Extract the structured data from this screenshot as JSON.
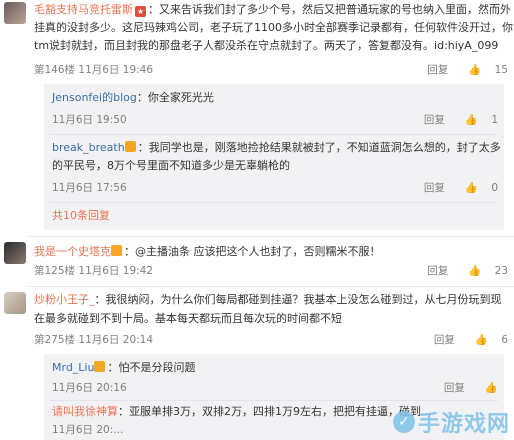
{
  "actions": {
    "reply": "回复",
    "like_glyph": "👍"
  },
  "comment1": {
    "user": "毛豁支持马竞托雷斯",
    "text_lines": [
      "：又来告诉我们封了多少个号，然后又把普通玩家的号也纳入里面，然而外",
      "挂真的没封多少。这尼玛辣鸡公司，老子玩了1100多小时全部赛季记录都有，任何软件没开过，你",
      "tm说封就封，而且封我的那盘老子人都没杀在守点就封了。两天了，答复都没有。id:hiyA_099"
    ],
    "floor": "第146楼",
    "time": "11月6日 19:46",
    "likes": "15",
    "replies": [
      {
        "user": "Jensonfei的blog",
        "text": "：你全家死光光",
        "time": "11月6日 19:50",
        "likes": "1"
      },
      {
        "user": "break_breath",
        "text_lines": [
          "：我同学也是，刚落地捡抢结果就被封了，不知道蓝洞怎么想的，封了太多",
          "的平民号，8万个号里面不知道多少是无辜躺枪的"
        ],
        "time": "11月6日 17:56",
        "likes": "0"
      }
    ],
    "more_replies": "共10条回复"
  },
  "comment2": {
    "user": "我是一个史塔克",
    "text": "：@主播油条 应该把这个人也封了，否则糯米不服！",
    "floor": "第125楼",
    "time": "11月6日 19:42",
    "likes": "23"
  },
  "comment3": {
    "user": "炒粉小王子_",
    "text_lines": [
      "：我很纳闷，为什么你们每局都碰到挂逼？我基本上没怎么碰到过，从七月份玩到现",
      "在最多就碰到不到十局。基本每天都玩而且每次玩的时间都不短"
    ],
    "floor": "第275楼",
    "time": "11月6日 20:14",
    "likes": "6",
    "replies": [
      {
        "user": "Mrd_Liu",
        "text": "：怕不是分段问题",
        "time": "11月6日 20:16"
      },
      {
        "user": "请叫我徐神算",
        "text": "：亚服单排3万，双排2万，四排1万9左右，把把有挂逼，碰到...",
        "time": "11月6日 20:..."
      }
    ]
  },
  "watermark": "手游戏网"
}
